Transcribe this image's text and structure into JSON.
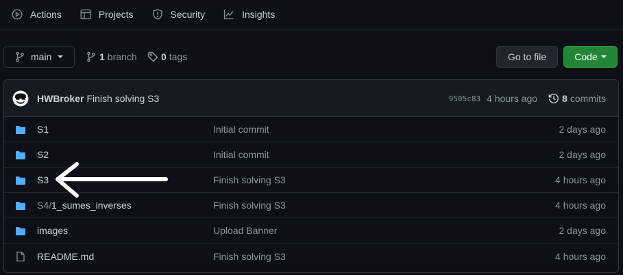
{
  "nav": {
    "items": [
      {
        "label": "Actions",
        "icon": "play-circle-icon"
      },
      {
        "label": "Projects",
        "icon": "table-icon"
      },
      {
        "label": "Security",
        "icon": "shield-icon"
      },
      {
        "label": "Insights",
        "icon": "graph-icon"
      }
    ]
  },
  "branch": {
    "current": "main",
    "branch_count": "1",
    "branch_label": "branch",
    "tag_count": "0",
    "tag_label": "tags"
  },
  "buttons": {
    "goto_file": "Go to file",
    "code": "Code"
  },
  "latest_commit": {
    "author": "HWBroker",
    "message": "Finish solving S3",
    "sha": "9505c83",
    "time": "4 hours ago",
    "commit_count": "8",
    "commit_label": "commits"
  },
  "files": [
    {
      "type": "folder",
      "name": "S1",
      "message": "Initial commit",
      "time": "2 days ago"
    },
    {
      "type": "folder",
      "name": "S2",
      "message": "Initial commit",
      "time": "2 days ago"
    },
    {
      "type": "folder",
      "name": "S3",
      "message": "Finish solving S3",
      "time": "4 hours ago"
    },
    {
      "type": "folder",
      "name_prefix": "S4/",
      "name": "1_sumes_inverses",
      "message": "Finish solving S3",
      "time": "4 hours ago"
    },
    {
      "type": "folder",
      "name": "images",
      "message": "Upload Banner",
      "time": "2 days ago"
    },
    {
      "type": "file",
      "name": "README.md",
      "message": "Finish solving S3",
      "time": "4 hours ago"
    }
  ],
  "colors": {
    "background": "#0d1117",
    "folder": "#54aeff",
    "code_button": "#238636",
    "annotation_arrow": "#ffffff"
  }
}
